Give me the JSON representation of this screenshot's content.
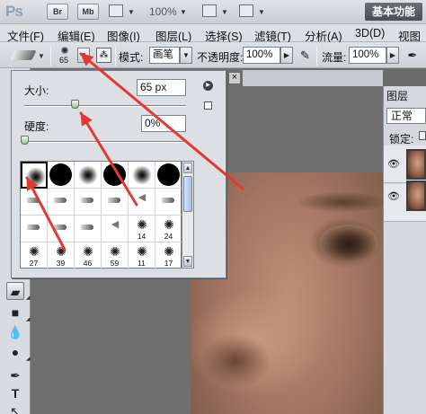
{
  "title_bar": {
    "app_logo": "Ps",
    "bridge_button": "Br",
    "minibridge_button": "Mb",
    "zoom_value": "100%",
    "workspace_button": "基本功能"
  },
  "menu": [
    "文件(F)",
    "编辑(E)",
    "图像(I)",
    "图层(L)",
    "选择(S)",
    "滤镜(T)",
    "分析(A)",
    "3D(D)",
    "视图"
  ],
  "options_bar": {
    "brush_size_number": "65",
    "mode_label": "模式:",
    "mode_value": "画笔",
    "opacity_label": "不透明度:",
    "opacity_value": "100%",
    "flow_label": "流量:",
    "flow_value": "100%"
  },
  "brush_picker": {
    "size_label": "大小:",
    "size_value": "65 px",
    "size_slider_fraction": 0.31,
    "hardness_label": "硬度:",
    "hardness_value": "0%",
    "hardness_slider_fraction": 0.0,
    "rows": [
      [
        {
          "kind": "soft",
          "label": "",
          "selected": true
        },
        {
          "kind": "hard",
          "label": ""
        },
        {
          "kind": "soft",
          "label": ""
        },
        {
          "kind": "hard",
          "label": ""
        },
        {
          "kind": "soft",
          "label": ""
        },
        {
          "kind": "hard",
          "label": ""
        }
      ],
      [
        {
          "kind": "pen",
          "label": ""
        },
        {
          "kind": "pen",
          "label": ""
        },
        {
          "kind": "pen",
          "label": ""
        },
        {
          "kind": "pen",
          "label": ""
        },
        {
          "kind": "fan",
          "label": ""
        },
        {
          "kind": "pen",
          "label": ""
        }
      ],
      [
        {
          "kind": "pen",
          "label": ""
        },
        {
          "kind": "pen",
          "label": ""
        },
        {
          "kind": "pen",
          "label": ""
        },
        {
          "kind": "fan",
          "label": ""
        },
        {
          "kind": "splat",
          "label": "14"
        },
        {
          "kind": "splat",
          "label": "24"
        }
      ],
      [
        {
          "kind": "splat",
          "label": "27"
        },
        {
          "kind": "splat",
          "label": "39"
        },
        {
          "kind": "splat",
          "label": "46"
        },
        {
          "kind": "splat",
          "label": "59"
        },
        {
          "kind": "splat",
          "label": "11"
        },
        {
          "kind": "splat",
          "label": "17"
        }
      ]
    ]
  },
  "layers_panel": {
    "tab_label": "图层",
    "blend_mode": "正常",
    "lock_label": "锁定:"
  },
  "annotation_color": "#e23a32"
}
